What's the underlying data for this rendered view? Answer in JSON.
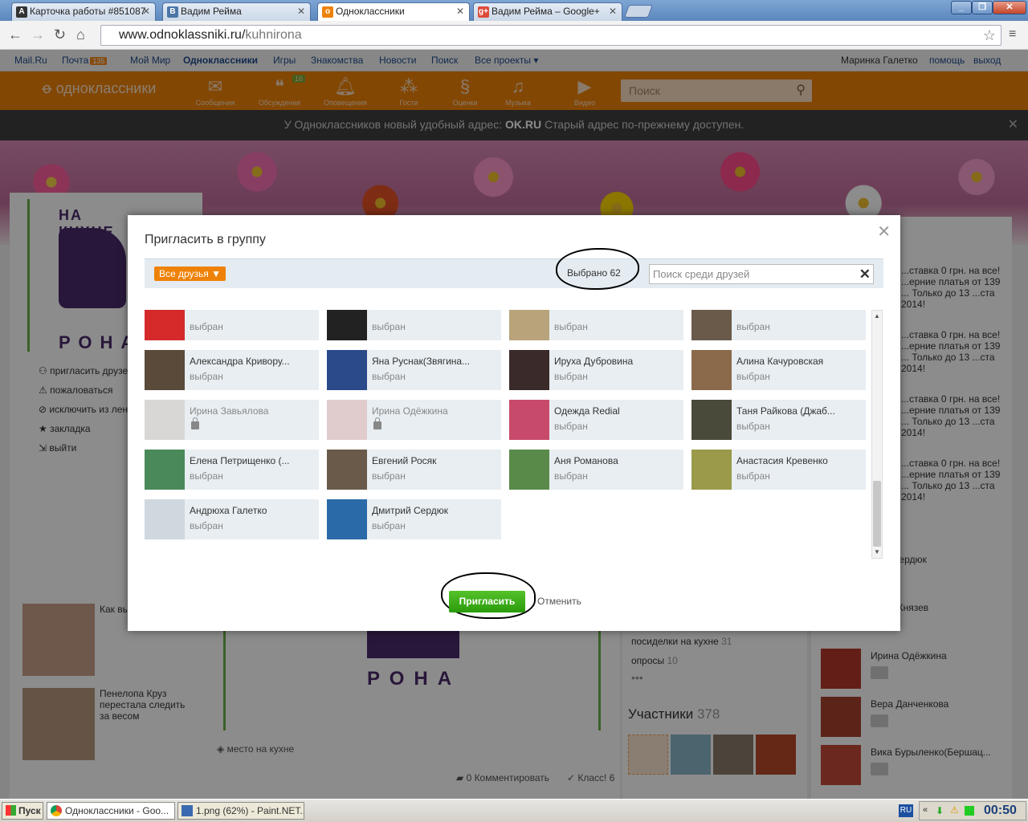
{
  "browser": {
    "tabs": [
      {
        "label": "Карточка работы #851087",
        "icon": "A",
        "color": "#333"
      },
      {
        "label": "Вадим Рейма",
        "icon": "B",
        "color": "#4a76a8"
      },
      {
        "label": "Одноклассники",
        "icon": "ok",
        "color": "#ee8208"
      },
      {
        "label": "Вадим Рейма – Google+",
        "icon": "g+",
        "color": "#dd4b39"
      }
    ],
    "url_host": "www.odnoklassniki.ru/",
    "url_path": "kuhnirona"
  },
  "mailbar": {
    "links": [
      "Mail.Ru",
      "Почта",
      "Мой Мир",
      "Одноклассники",
      "Игры",
      "Знакомства",
      "Новости",
      "Поиск",
      "Все проекты ▾"
    ],
    "mail_count": "135",
    "user": "Маринка Галетко",
    "help": "помощь",
    "logout": "выход"
  },
  "okbar": {
    "logo": "одноклассники",
    "icons": [
      {
        "label": "Сообщения",
        "glyph": "✉"
      },
      {
        "label": "Обсуждения",
        "glyph": "💬",
        "badge": "16"
      },
      {
        "label": "Оповещения",
        "glyph": "🔔"
      },
      {
        "label": "Гости",
        "glyph": "👣"
      },
      {
        "label": "Оценки",
        "glyph": "$"
      },
      {
        "label": "Музыка",
        "glyph": "♫"
      },
      {
        "label": "Видео",
        "glyph": "🎥"
      }
    ],
    "search_placeholder": "Поиск"
  },
  "notice": {
    "pre": "У Одноклассников новый удобный адрес:",
    "link": "OK.RU",
    "post": "Старый адрес по-прежнему доступен."
  },
  "left_menu": [
    "пригласить друзей",
    "пожаловаться",
    "исключить из ленты",
    "закладка",
    "выйти"
  ],
  "group_logo": {
    "top": "НА КУХНЕ",
    "bottom": "РОНА"
  },
  "left_feed": [
    {
      "text": "Как вы... косточ..."
    },
    {
      "text": "Пенелопа Круз перестала следить за весом"
    }
  ],
  "right_ads": [
    "...ставка 0 грн. на все! ...ерние платья от 139 ... Только до 13 ...ста 2014!"
  ],
  "right_members": [
    "...ий Сердюк",
    "...ндр Князев",
    "Ирина Одёжкина",
    "Вера Данченкова",
    "Вика Бурыленко(Бершац..."
  ],
  "mid": {
    "place": "место на кухне",
    "comments": "0 Комментировать",
    "klass": "Класс! 6"
  },
  "mid_right": {
    "links": [
      {
        "label": "посиделки на кухне",
        "count": "31"
      },
      {
        "label": "опросы",
        "count": "10"
      }
    ],
    "members_title": "Участники",
    "members_count": "378"
  },
  "modal": {
    "title": "Пригласить в группу",
    "filter": "Все друзья ▼",
    "selected": "Выбрано 62",
    "search_placeholder": "Поиск среди друзей",
    "invite": "Пригласить",
    "cancel": "Отменить",
    "friends": [
      {
        "name": "",
        "status": "выбран",
        "locked": false,
        "c": "#d42a2a"
      },
      {
        "name": "",
        "status": "выбран",
        "locked": false,
        "c": "#222"
      },
      {
        "name": "",
        "status": "выбран",
        "locked": false,
        "c": "#b9a37a"
      },
      {
        "name": "",
        "status": "выбран",
        "locked": false,
        "c": "#6a5a4a"
      },
      {
        "name": "Александра Кривору...",
        "status": "выбран",
        "locked": false,
        "c": "#5a4a3a"
      },
      {
        "name": "Яна Руснак(Звягина...",
        "status": "выбран",
        "locked": false,
        "c": "#2a4a8a"
      },
      {
        "name": "Ируха Дубровина",
        "status": "выбран",
        "locked": false,
        "c": "#3a2a2a"
      },
      {
        "name": "Алина Качуровская",
        "status": "выбран",
        "locked": false,
        "c": "#8a6a4a"
      },
      {
        "name": "Ирина Завьялова",
        "status": "",
        "locked": true,
        "c": "#c8c0b8"
      },
      {
        "name": "Ирина Одёжкина",
        "status": "",
        "locked": true,
        "c": "#d8a8a8"
      },
      {
        "name": "Одежда Redial",
        "status": "выбран",
        "locked": false,
        "c": "#c84a6a"
      },
      {
        "name": "Таня Райкова (Джаб...",
        "status": "выбран",
        "locked": false,
        "c": "#4a4a3a"
      },
      {
        "name": "Елена Петрищенко (...",
        "status": "выбран",
        "locked": false,
        "c": "#4a8a5a"
      },
      {
        "name": "Евгений Росяк",
        "status": "выбран",
        "locked": false,
        "c": "#6a5a4a"
      },
      {
        "name": "Аня Романова",
        "status": "выбран",
        "locked": false,
        "c": "#5a8a4a"
      },
      {
        "name": "Анастасия Кревенко",
        "status": "выбран",
        "locked": false,
        "c": "#9a9a4a"
      },
      {
        "name": "Андрюха Галетко",
        "status": "выбран",
        "locked": false,
        "c": "#cfd8de"
      },
      {
        "name": "Дмитрий Сердюк",
        "status": "выбран",
        "locked": false,
        "c": "#2a6aa8"
      }
    ]
  },
  "taskbar": {
    "start": "Пуск",
    "items": [
      "Одноклассники - Goo...",
      "1.png (62%) - Paint.NET..."
    ],
    "lang": "RU",
    "time": "00:50"
  }
}
